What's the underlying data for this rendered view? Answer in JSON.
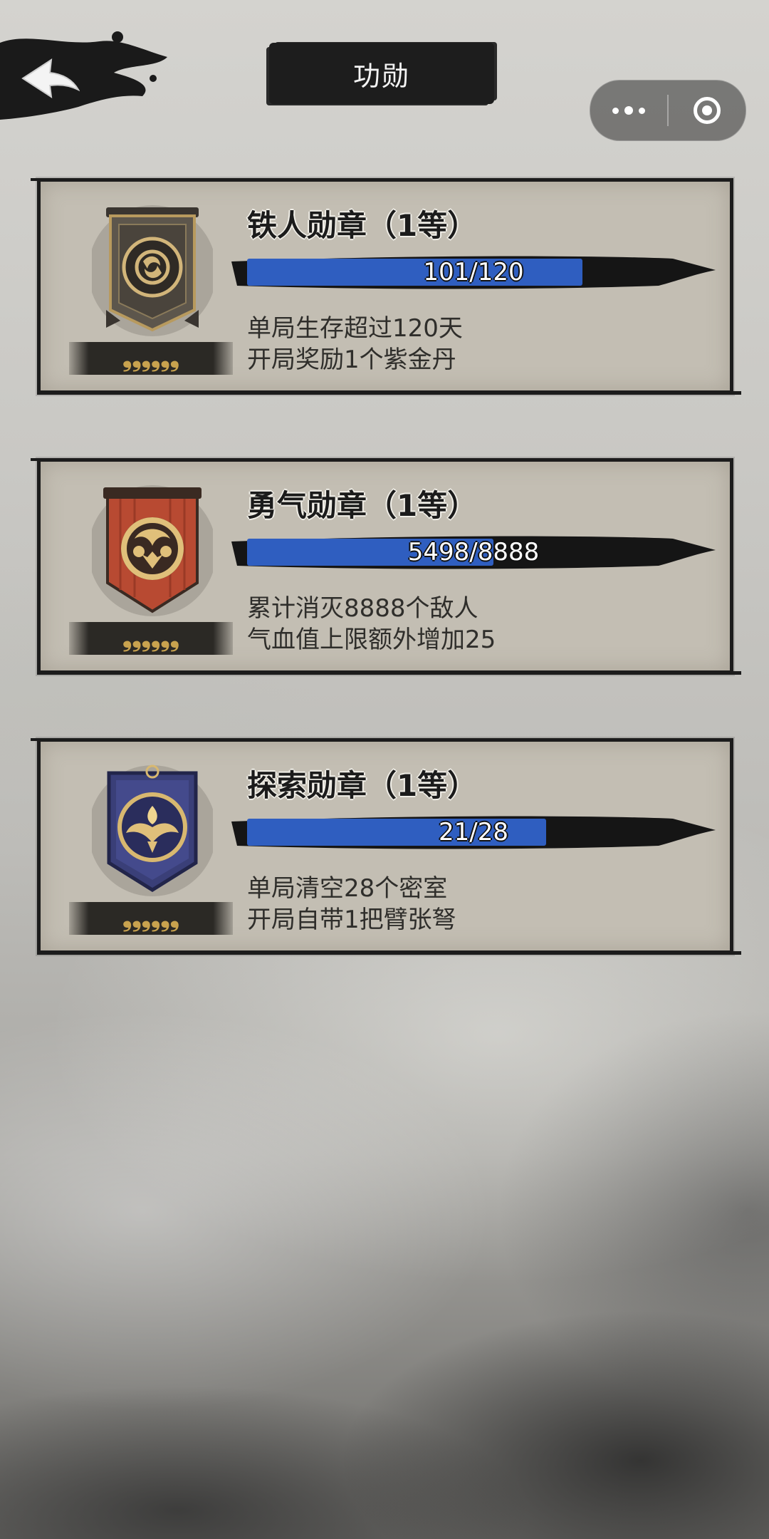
{
  "header": {
    "title": "功勋"
  },
  "colors": {
    "progress_fill": "#2f5ec0",
    "star_color": "#c8a24e"
  },
  "medals": [
    {
      "name": "铁人勋章（1等）",
      "progress_text": "101/120",
      "progress_value": 101,
      "progress_max": 120,
      "desc1": "单局生存超过120天",
      "desc2": "开局奖励1个紫金丹",
      "stars": "❟❟❟❟❟❟",
      "badge_style": "iron"
    },
    {
      "name": "勇气勋章（1等）",
      "progress_text": "5498/8888",
      "progress_value": 5498,
      "progress_max": 8888,
      "desc1": "累计消灭8888个敌人",
      "desc2": "气血值上限额外增加25",
      "stars": "❟❟❟❟❟❟",
      "badge_style": "courage"
    },
    {
      "name": "探索勋章（1等）",
      "progress_text": "21/28",
      "progress_value": 21,
      "progress_max": 28,
      "desc1": "单局清空28个密室",
      "desc2": "开局自带1把臂张弩",
      "stars": "❟❟❟❟❟❟",
      "badge_style": "explore"
    }
  ]
}
